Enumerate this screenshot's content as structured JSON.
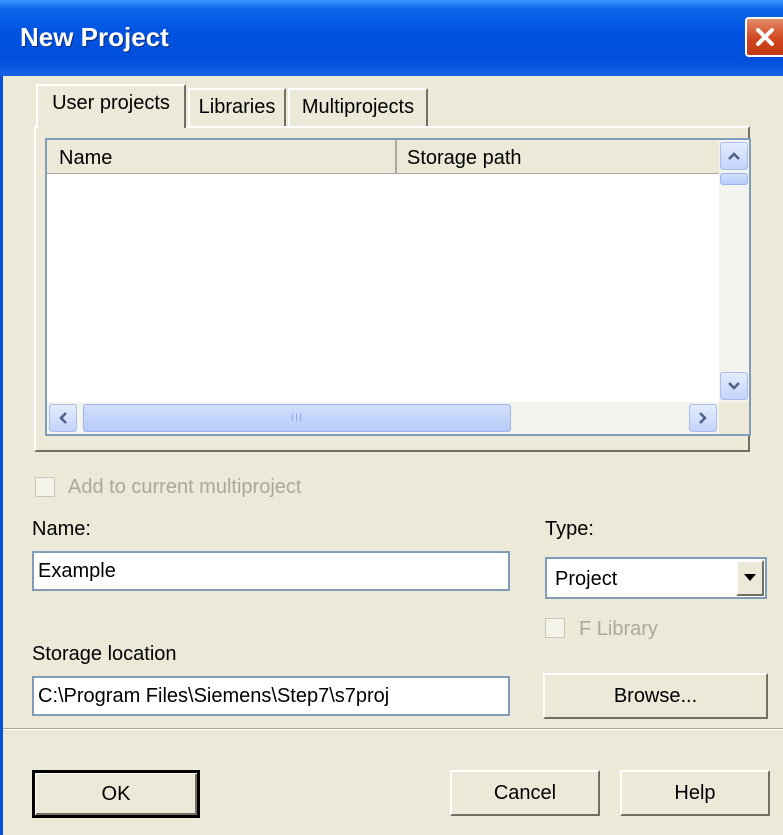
{
  "window": {
    "title": "New Project"
  },
  "tabs": [
    {
      "label": "User projects",
      "active": true
    },
    {
      "label": "Libraries",
      "active": false
    },
    {
      "label": "Multiprojects",
      "active": false
    }
  ],
  "list": {
    "columns": [
      "Name",
      "Storage path"
    ],
    "rows": [],
    "hscroll_thumb_label": "III"
  },
  "add_to_multiproject": {
    "label": "Add to current multiproject",
    "checked": false,
    "enabled": false
  },
  "name_field": {
    "label": "Name:",
    "value": "Example"
  },
  "type_field": {
    "label": "Type:",
    "value": "Project"
  },
  "f_library": {
    "label": "F Library",
    "checked": false,
    "enabled": false
  },
  "storage": {
    "label": "Storage location",
    "value": "C:\\Program Files\\Siemens\\Step7\\s7proj"
  },
  "buttons": {
    "browse": "Browse...",
    "ok": "OK",
    "cancel": "Cancel",
    "help": "Help"
  },
  "colors": {
    "titlebar": "#0052e0",
    "dialog_bg": "#ece9d8",
    "close_button": "#d0461f"
  }
}
